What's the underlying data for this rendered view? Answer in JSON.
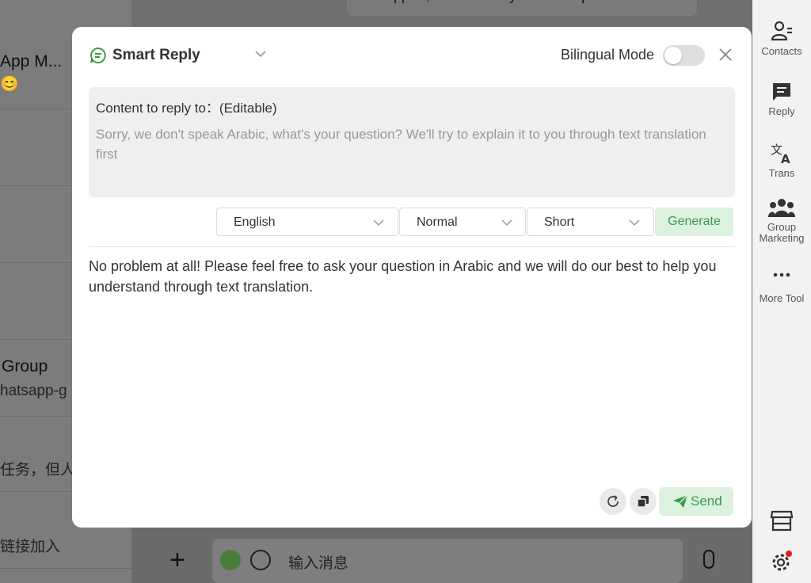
{
  "background": {
    "chat_list": [
      {
        "title": "App M...",
        "subtitle": "😊"
      },
      {
        "title": "",
        "subtitle": ""
      },
      {
        "title": "",
        "subtitle": ""
      },
      {
        "title": "",
        "subtitle": ""
      },
      {
        "title": "Group",
        "subtitle": "hatsapp-g"
      },
      {
        "title": "",
        "subtitle": "任务，但人"
      },
      {
        "title": "",
        "subtitle": "链接加入"
      }
    ],
    "chat_bubble": "No support, I need to buy the basic plan for the test",
    "composer_placeholder": "输入消息"
  },
  "toolbar": {
    "items": [
      {
        "label": "Contacts",
        "icon": "contacts-icon"
      },
      {
        "label": "Reply",
        "icon": "reply-icon"
      },
      {
        "label": "Trans",
        "icon": "translate-icon"
      },
      {
        "label": "Group\nMarketing",
        "icon": "group-icon"
      },
      {
        "label": "More Tool",
        "icon": "more-icon"
      }
    ]
  },
  "modal": {
    "title": "Smart Reply",
    "bilingual_label": "Bilingual Mode",
    "bilingual_on": false,
    "content_label": "Content to reply to：(Editable)",
    "content_text": "Sorry, we don't speak Arabic, what's your question? We'll try to explain it to you through text translation first",
    "selects": {
      "language": "English",
      "tone": "Normal",
      "length": "Short"
    },
    "generate_label": "Generate",
    "reply_text": "No problem at all! Please feel free to ask your question in Arabic and we will do our best to help you understand through text translation.",
    "send_label": "Send"
  },
  "colors": {
    "accent_green": "#3a9a4a",
    "accent_green_bg": "#ddf1df"
  }
}
